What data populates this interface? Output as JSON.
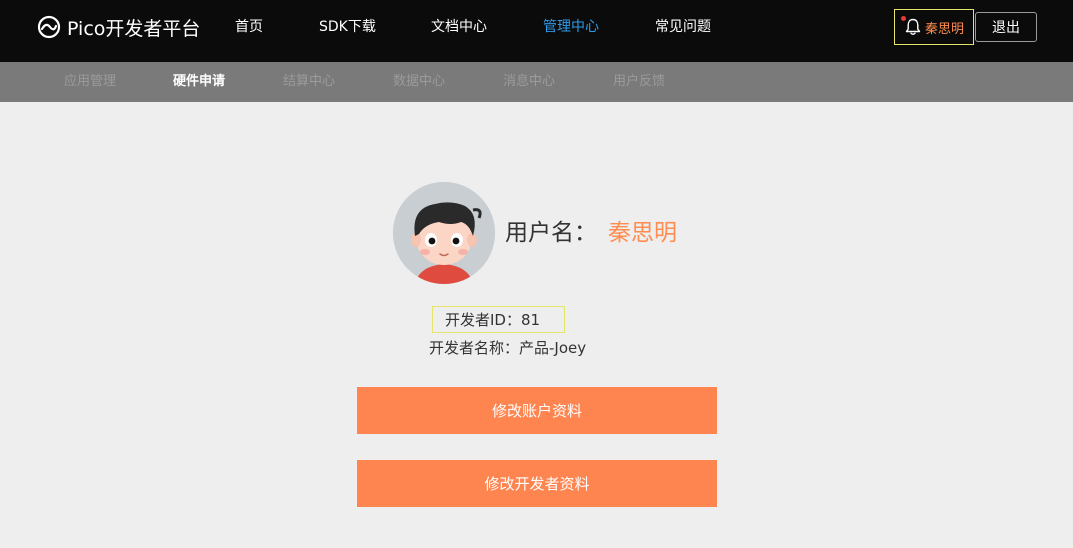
{
  "brand": {
    "name": "Pico开发者平台",
    "icon": "pico-logo-icon"
  },
  "nav": {
    "items": [
      {
        "label": "首页"
      },
      {
        "label": "SDK下载"
      },
      {
        "label": "文档中心"
      },
      {
        "label": "管理中心",
        "active": true
      },
      {
        "label": "常见问题"
      }
    ],
    "active_color": "#2e9be8"
  },
  "user_menu": {
    "icon": "bell-icon",
    "username": "秦思明",
    "logout_label": "退出"
  },
  "subnav": {
    "items": [
      {
        "label": "应用管理"
      },
      {
        "label": "硬件申请",
        "active": true
      },
      {
        "label": "结算中心"
      },
      {
        "label": "数据中心"
      },
      {
        "label": "消息中心"
      },
      {
        "label": "用户反馈"
      }
    ]
  },
  "profile": {
    "avatar": "cartoon-boy-avatar",
    "username_label": "用户名：",
    "username": "秦思明",
    "developer_id": "开发者ID：81",
    "developer_name": "开发者名称：产品-Joey"
  },
  "actions": {
    "edit_account": "修改账户资料",
    "edit_developer": "修改开发者资料"
  },
  "colors": {
    "accent": "#ff8550",
    "topbar": "#0b0b0b",
    "subbar": "#7a7a7a",
    "background": "#eeeeee"
  }
}
